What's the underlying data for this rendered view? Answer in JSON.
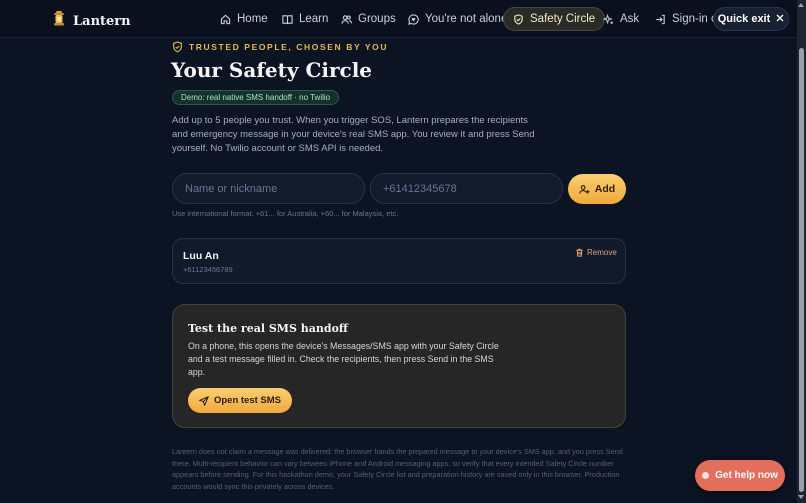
{
  "nav": {
    "brand": "Lantern",
    "items": [
      {
        "label": "Home",
        "icon": "home-icon"
      },
      {
        "label": "Learn",
        "icon": "book-icon"
      },
      {
        "label": "Groups",
        "icon": "users-icon"
      },
      {
        "label": "You're not alone",
        "icon": "message-heart-icon"
      },
      {
        "label": "Safety Circle",
        "icon": "shield-check-icon",
        "active": true
      },
      {
        "label": "Ask",
        "icon": "sparkles-icon"
      },
      {
        "label": "Sign-in co",
        "icon": "sign-in-icon"
      }
    ],
    "quick_exit": "Quick exit"
  },
  "page": {
    "eyebrow": "TRUSTED PEOPLE, CHOSEN BY YOU",
    "title": "Your Safety Circle",
    "badge": "Demo: real native SMS handoff · no Twilio",
    "intro": "Add up to 5 people you trust. When you trigger SOS, Lantern prepares the recipients and emergency message in your device's real SMS app. You review it and press Send yourself. No Twilio account or SMS API is needed."
  },
  "form": {
    "name_placeholder": "Name or nickname",
    "phone_placeholder": "+61412345678",
    "add_label": "Add",
    "hint": "Use international format: +61... for Australia, +60... for Malaysia, etc."
  },
  "contacts": [
    {
      "name": "Luu An",
      "phone": "+61123456789",
      "remove_label": "Remove"
    }
  ],
  "test": {
    "title": "Test the real SMS handoff",
    "description": "On a phone, this opens the device's Messages/SMS app with your Safety Circle and a test message filled in. Check the recipients, then press Send in the SMS app.",
    "button": "Open test SMS"
  },
  "disclaimer": "Lantern does not claim a message was delivered: the browser hands the prepared message to your device's SMS app, and you press Send there. Multi-recipient behavior can vary between iPhone and Android messaging apps, so verify that every intended Safety Circle number appears before sending. For this hackathon demo, your Safety Circle list and preparation history are saved only in this browser. Production accounts would sync this privately across devices.",
  "help_button": "Get help now",
  "colors": {
    "accent": "#f0a93c",
    "background": "#0c1322",
    "danger": "#e36e5c",
    "success": "#a4e4c8"
  }
}
